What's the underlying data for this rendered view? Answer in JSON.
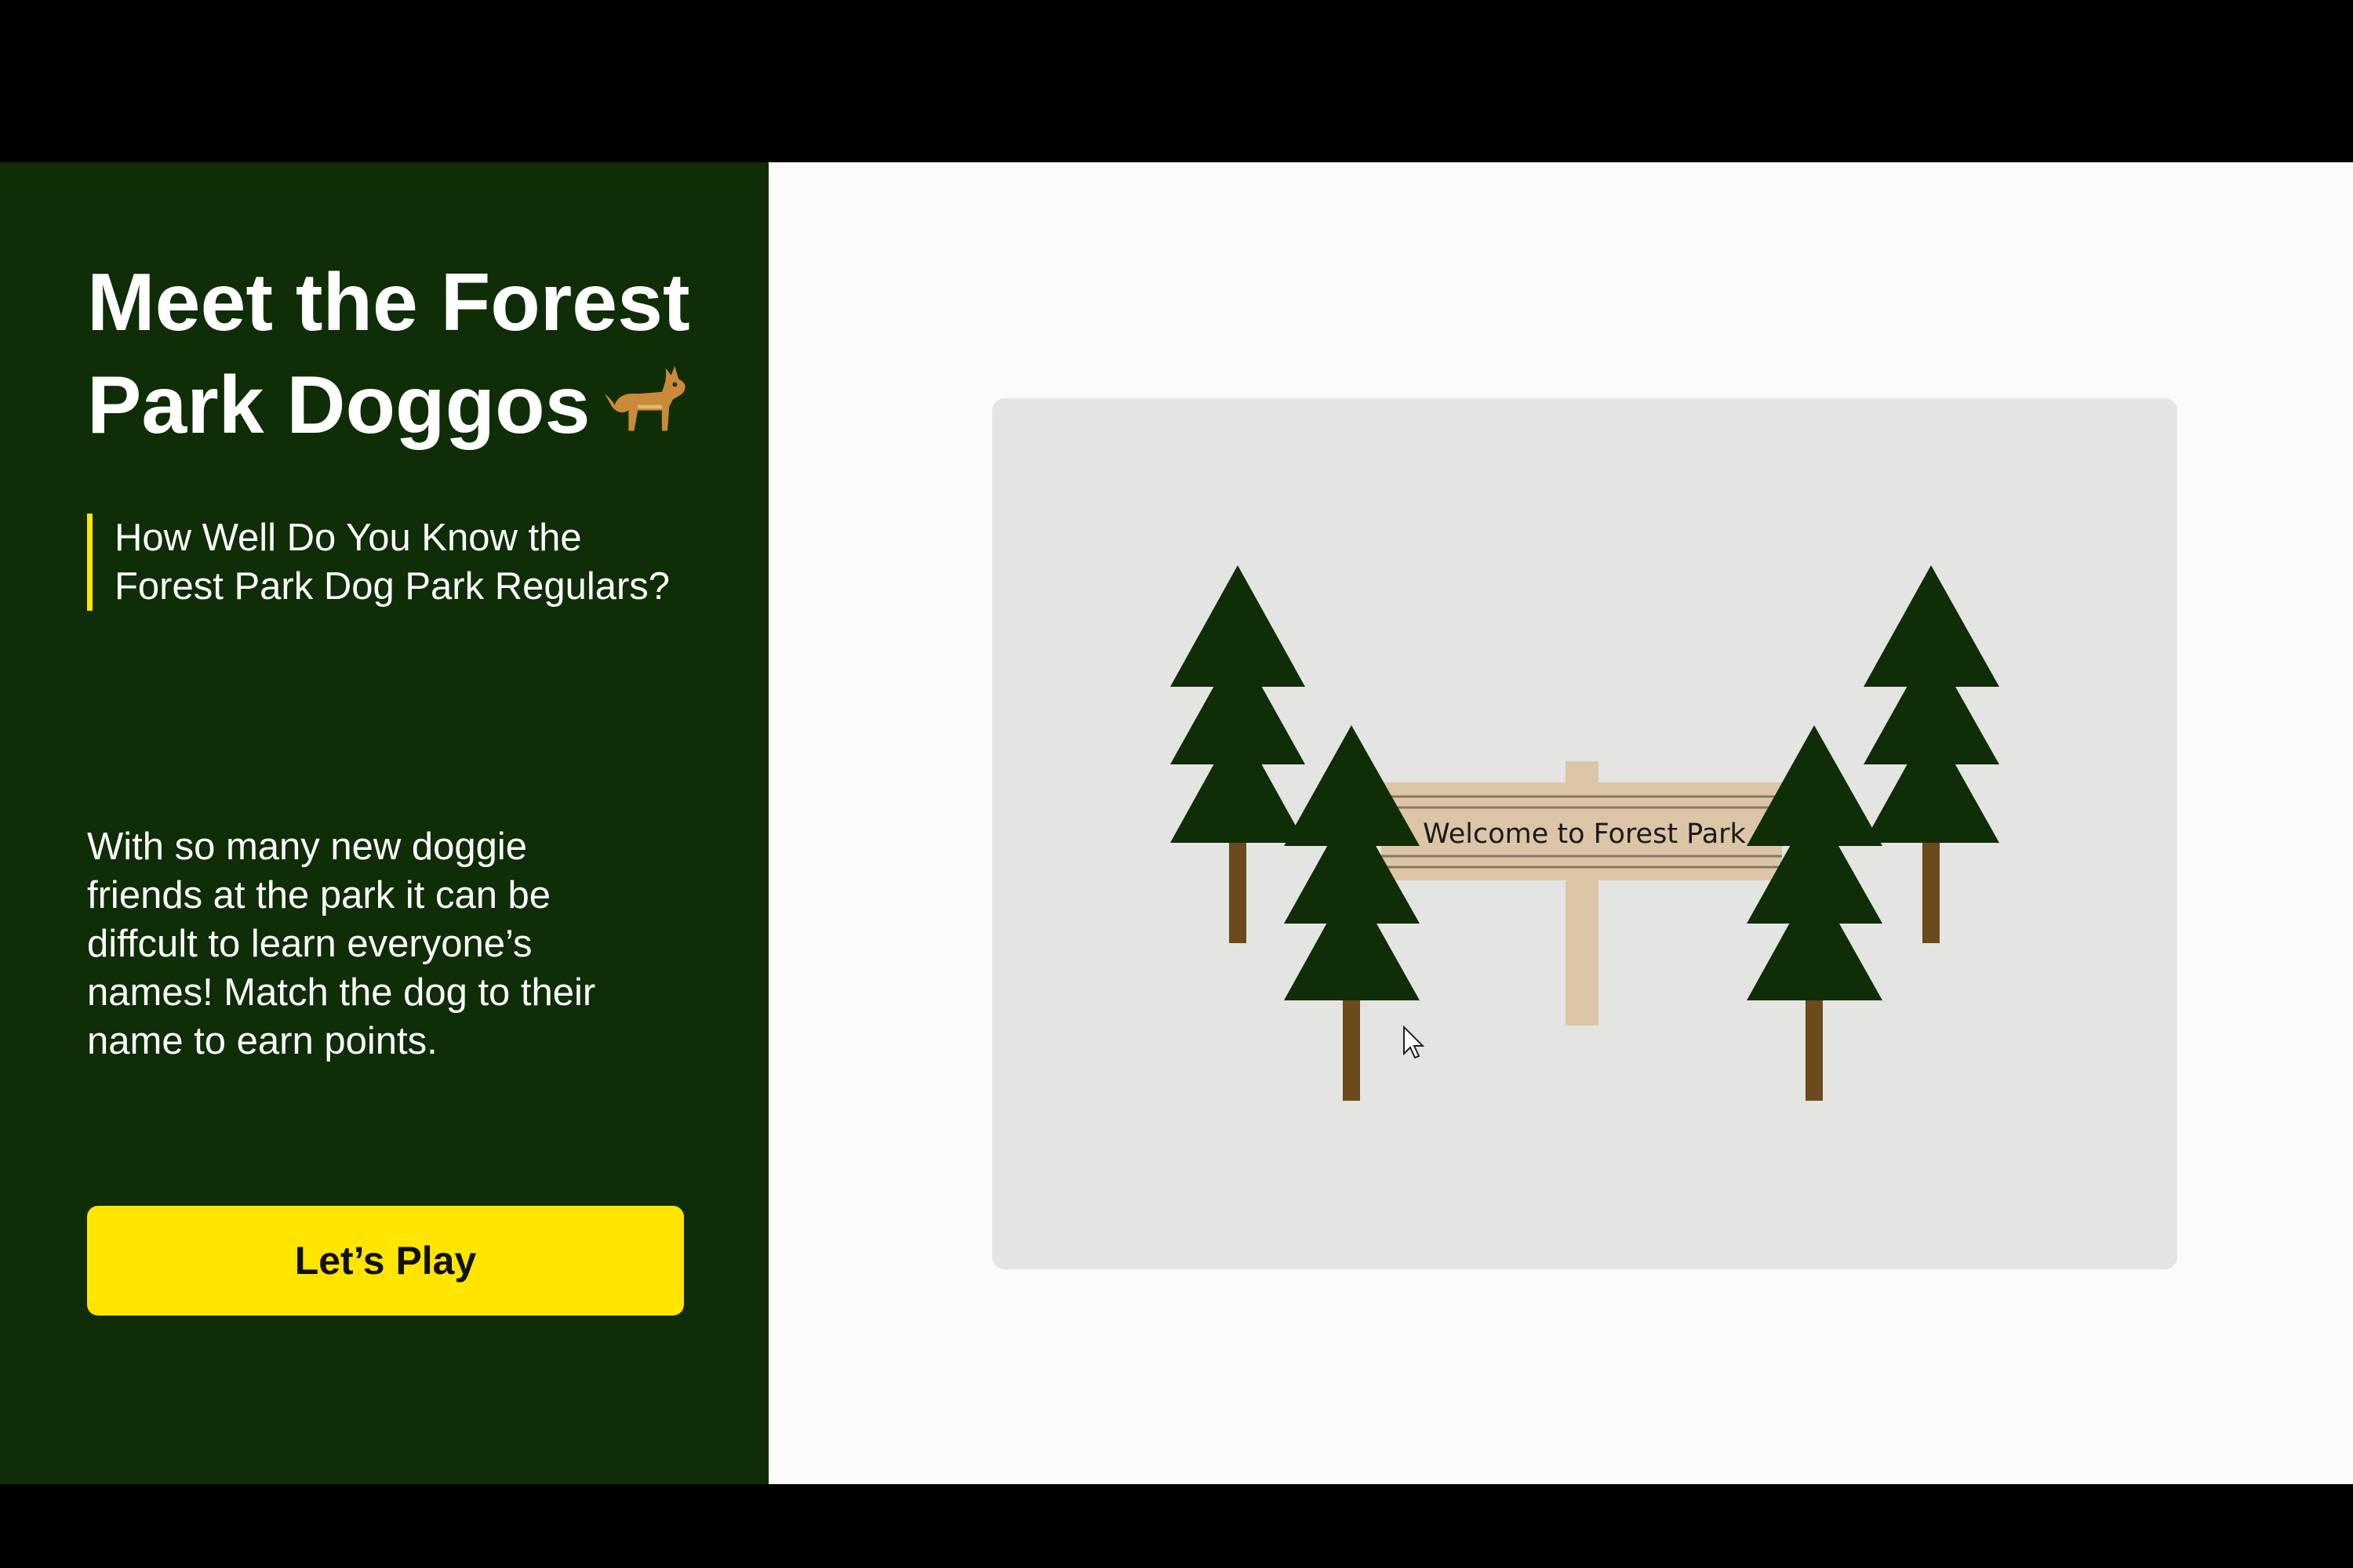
{
  "sidebar": {
    "title": "Meet the Forest Park Doggos",
    "title_line1": "Meet the Forest",
    "title_line2": "Park Doggos",
    "title_icon": "dog-emoji-icon",
    "subtitle_line1": "How Well Do You Know the",
    "subtitle_line2": "Forest Park Dog Park Regulars?",
    "description_lines": [
      "With so many new doggie",
      "friends at the park it can be",
      "diffcult to learn everyone’s",
      "names! Match the dog to their",
      "name to earn points."
    ],
    "play_button_label": "Let’s Play"
  },
  "scene": {
    "sign_text": "Welcome to Forest Park",
    "icons": [
      "pine-tree-icon",
      "wooden-sign-icon",
      "mouse-cursor-icon"
    ]
  },
  "colors": {
    "sidebar_bg": "#0f2d07",
    "accent_yellow": "#ffe500",
    "tree_green": "#0f2d07",
    "trunk_brown": "#6b4b1b",
    "sign_wood": "#dcc5a6",
    "main_bg": "#fafaf8",
    "card_bg": "#e4e4e2"
  }
}
